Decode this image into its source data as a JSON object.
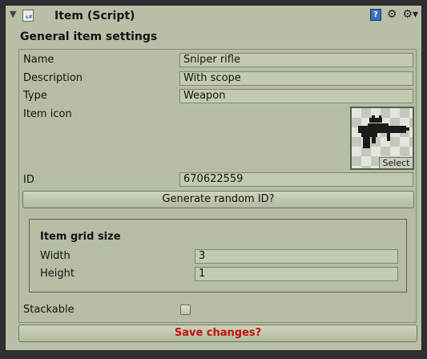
{
  "header": {
    "title": "Item (Script)",
    "script_icon": "cs-script-icon",
    "foldout_icon": "triangle-down-icon",
    "help_icon": "help-book-icon",
    "help_glyph": "?",
    "presets_icon": "presets-icon",
    "gear_icon": "gear-icon"
  },
  "section_title": "General item settings",
  "fields": {
    "name_label": "Name",
    "name_value": "Sniper rifle",
    "description_label": "Description",
    "description_value": "With scope",
    "type_label": "Type",
    "type_value": "Weapon",
    "item_icon_label": "Item icon",
    "item_icon_image": "sniper-rifle-icon",
    "select_label": "Select",
    "id_label": "ID",
    "id_value": "670622559"
  },
  "generate_button": "Generate random ID?",
  "grid": {
    "title": "Item grid size",
    "width_label": "Width",
    "width_value": "3",
    "height_label": "Height",
    "height_value": "1"
  },
  "stackable_label": "Stackable",
  "stackable_checked": false,
  "save_button": "Save changes?",
  "colors": {
    "panel_bg": "#b7c0a6",
    "save_text": "#c40d0d",
    "help_icon": "#3a6fb8"
  }
}
